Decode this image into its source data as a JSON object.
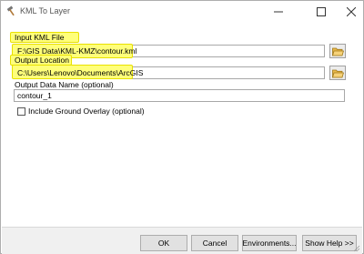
{
  "window": {
    "title": "KML To Layer"
  },
  "form": {
    "input_kml": {
      "label": "Input KML File",
      "value": "F:\\GIS Data\\KML-KMZ\\contour.kml"
    },
    "output_location": {
      "label": "Output Location",
      "value": "C:\\Users\\Lenovo\\Documents\\ArcGIS"
    },
    "output_name": {
      "label": "Output Data Name (optional)",
      "value": "contour_1"
    },
    "include_ground_overlay": {
      "label": "Include Ground Overlay (optional)",
      "checked": false
    }
  },
  "buttons": {
    "ok": "OK",
    "cancel": "Cancel",
    "environments": "Environments...",
    "show_help": "Show Help >>"
  },
  "colors": {
    "highlight": "#ffff7a",
    "folder": "#e8b84a"
  }
}
